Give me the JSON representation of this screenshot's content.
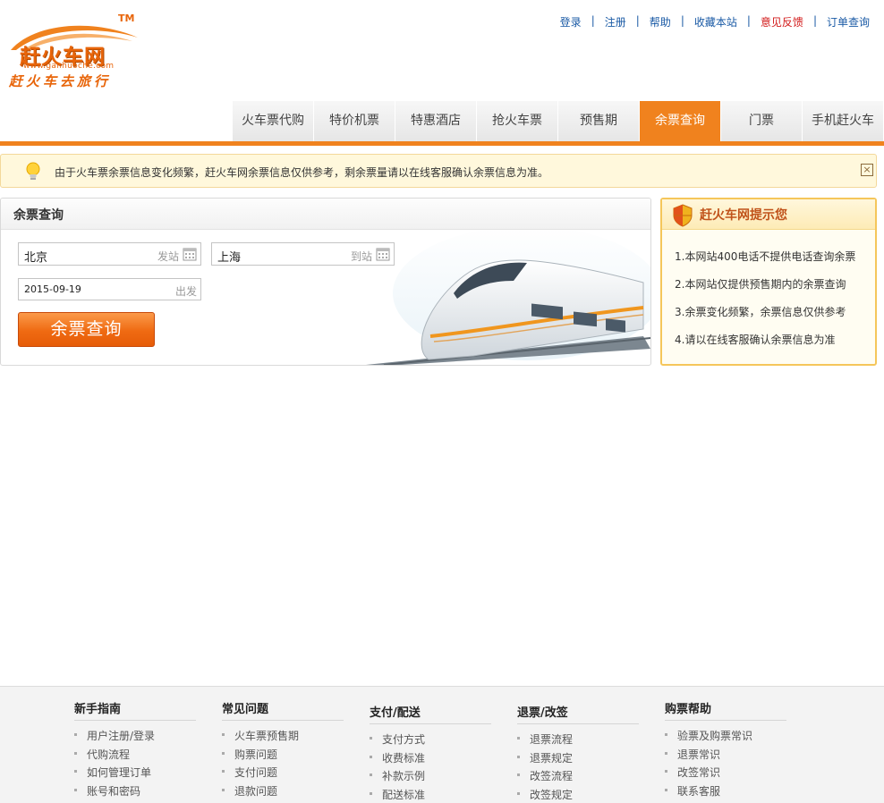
{
  "logo": {
    "brand": "赶火车网",
    "tm": "TM",
    "url": "www.ganhuoche.com",
    "slogan": "赶火车去旅行"
  },
  "toplinks": [
    {
      "label": "登录"
    },
    {
      "label": "注册"
    },
    {
      "label": "帮助"
    },
    {
      "label": "收藏本站"
    },
    {
      "label": "意见反馈"
    },
    {
      "label": "订单查询"
    }
  ],
  "nav": {
    "tabs": [
      {
        "label": "火车票代购"
      },
      {
        "label": "特价机票"
      },
      {
        "label": "特惠酒店"
      },
      {
        "label": "抢火车票"
      },
      {
        "label": "预售期"
      },
      {
        "label": "余票查询"
      },
      {
        "label": "门票"
      },
      {
        "label": "手机赶火车"
      }
    ],
    "active": "余票查询"
  },
  "notice": {
    "text": "由于火车票余票信息变化频繁，赶火车网余票信息仅供参考，剩余票量请以在线客服确认余票信息为准。"
  },
  "query": {
    "title": "余票查询",
    "from": {
      "value": "北京",
      "hint": "发站"
    },
    "to": {
      "value": "上海",
      "hint": "到站"
    },
    "date": {
      "value": "2015-09-19",
      "hint": "出发"
    },
    "button": "余票查询"
  },
  "tips": {
    "title": "赶火车网提示您",
    "items": [
      "1.本网站400电话不提供电话查询余票",
      "2.本网站仅提供预售期内的余票查询",
      "3.余票变化频繁，余票信息仅供参考",
      "4.请以在线客服确认余票信息为准"
    ]
  },
  "footer": {
    "columns": [
      {
        "title": "新手指南",
        "links": [
          "用户注册/登录",
          "代购流程",
          "如何管理订单",
          "账号和密码"
        ]
      },
      {
        "title": "常见问题",
        "links": [
          "火车票预售期",
          "购票问题",
          "支付问题",
          "退款问题"
        ]
      },
      {
        "title": "支付/配送",
        "links": [
          "支付方式",
          "收费标准",
          "补款示例",
          "配送标准"
        ]
      },
      {
        "title": "退票/改签",
        "links": [
          "退票流程",
          "退票规定",
          "改签流程",
          "改签规定"
        ]
      },
      {
        "title": "购票帮助",
        "links": [
          "验票及购票常识",
          "退票常识",
          "改签常识",
          "联系客服"
        ]
      }
    ]
  },
  "colors": {
    "brand_orange": "#f0821e",
    "link_blue": "#1a5aa5",
    "feedback_red": "#d21a1a"
  }
}
